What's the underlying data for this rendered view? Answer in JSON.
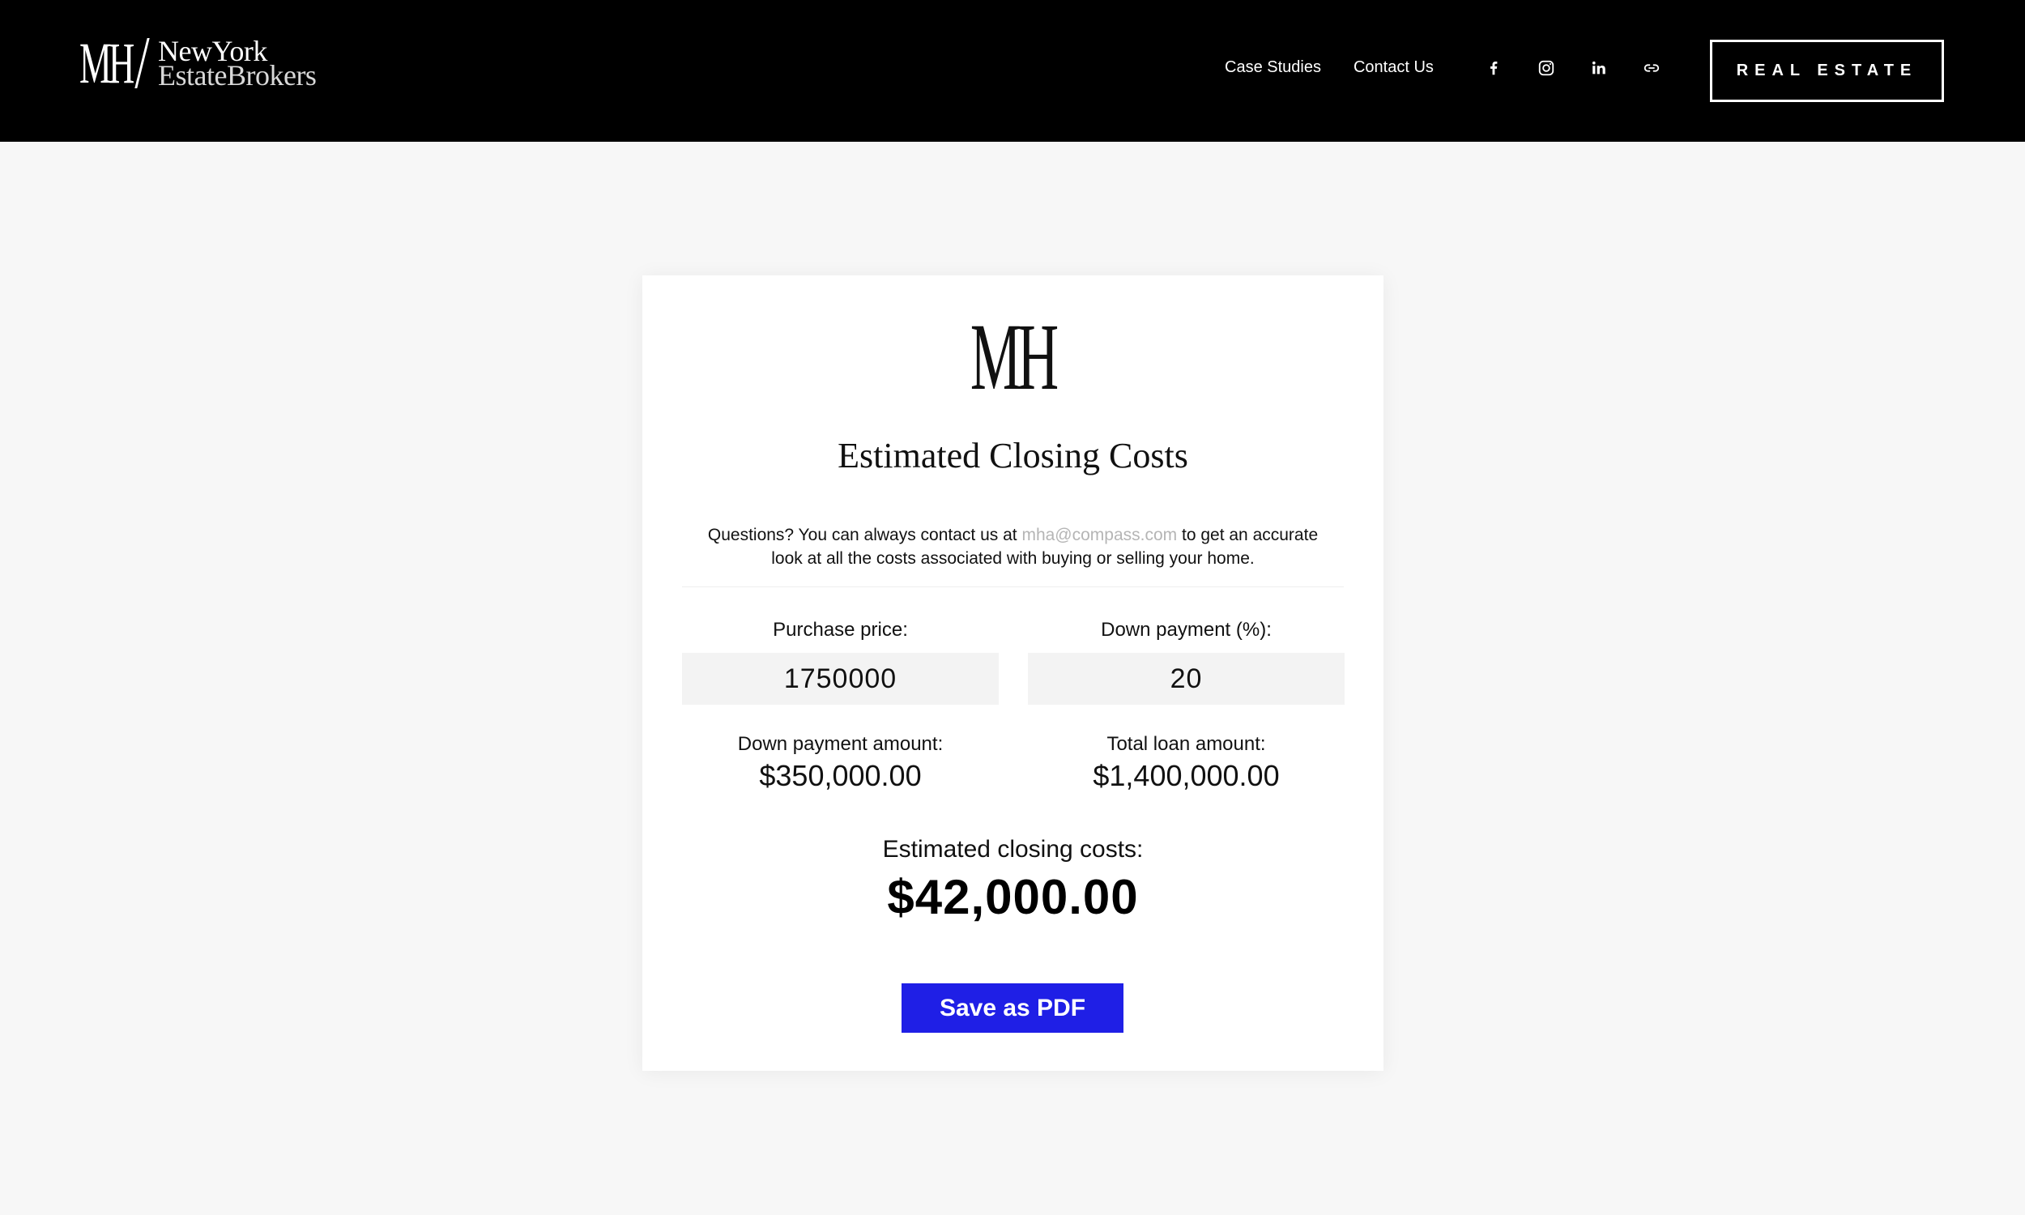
{
  "header": {
    "brand": {
      "monogram": "MH",
      "line1": "NewYork",
      "line2": "EstateBrokers"
    },
    "nav": [
      {
        "label": "Case Studies"
      },
      {
        "label": "Contact Us"
      }
    ],
    "social_icons": [
      "facebook-icon",
      "instagram-icon",
      "linkedin-icon",
      "link-icon"
    ],
    "cta_label": "REAL ESTATE"
  },
  "card": {
    "logo": "MH",
    "title": "Estimated Closing Costs",
    "intro_before": "Questions? You can always contact us at ",
    "intro_email": "mha@compass.com",
    "intro_after": " to get an accurate look at all the costs associated with buying or selling your home.",
    "purchase_price_label": "Purchase price:",
    "purchase_price_value": "1750000",
    "down_payment_pct_label": "Down payment (%):",
    "down_payment_pct_value": "20",
    "down_payment_amount_label": "Down payment amount:",
    "down_payment_amount_value": "$350,000.00",
    "total_loan_label": "Total loan amount:",
    "total_loan_value": "$1,400,000.00",
    "closing_costs_label": "Estimated closing costs:",
    "closing_costs_value": "$42,000.00",
    "save_button_label": "Save as PDF"
  },
  "colors": {
    "header_bg": "#000000",
    "page_bg": "#f7f7f7",
    "button_bg": "#1f1fe6",
    "email_link": "#b5b5b5"
  }
}
